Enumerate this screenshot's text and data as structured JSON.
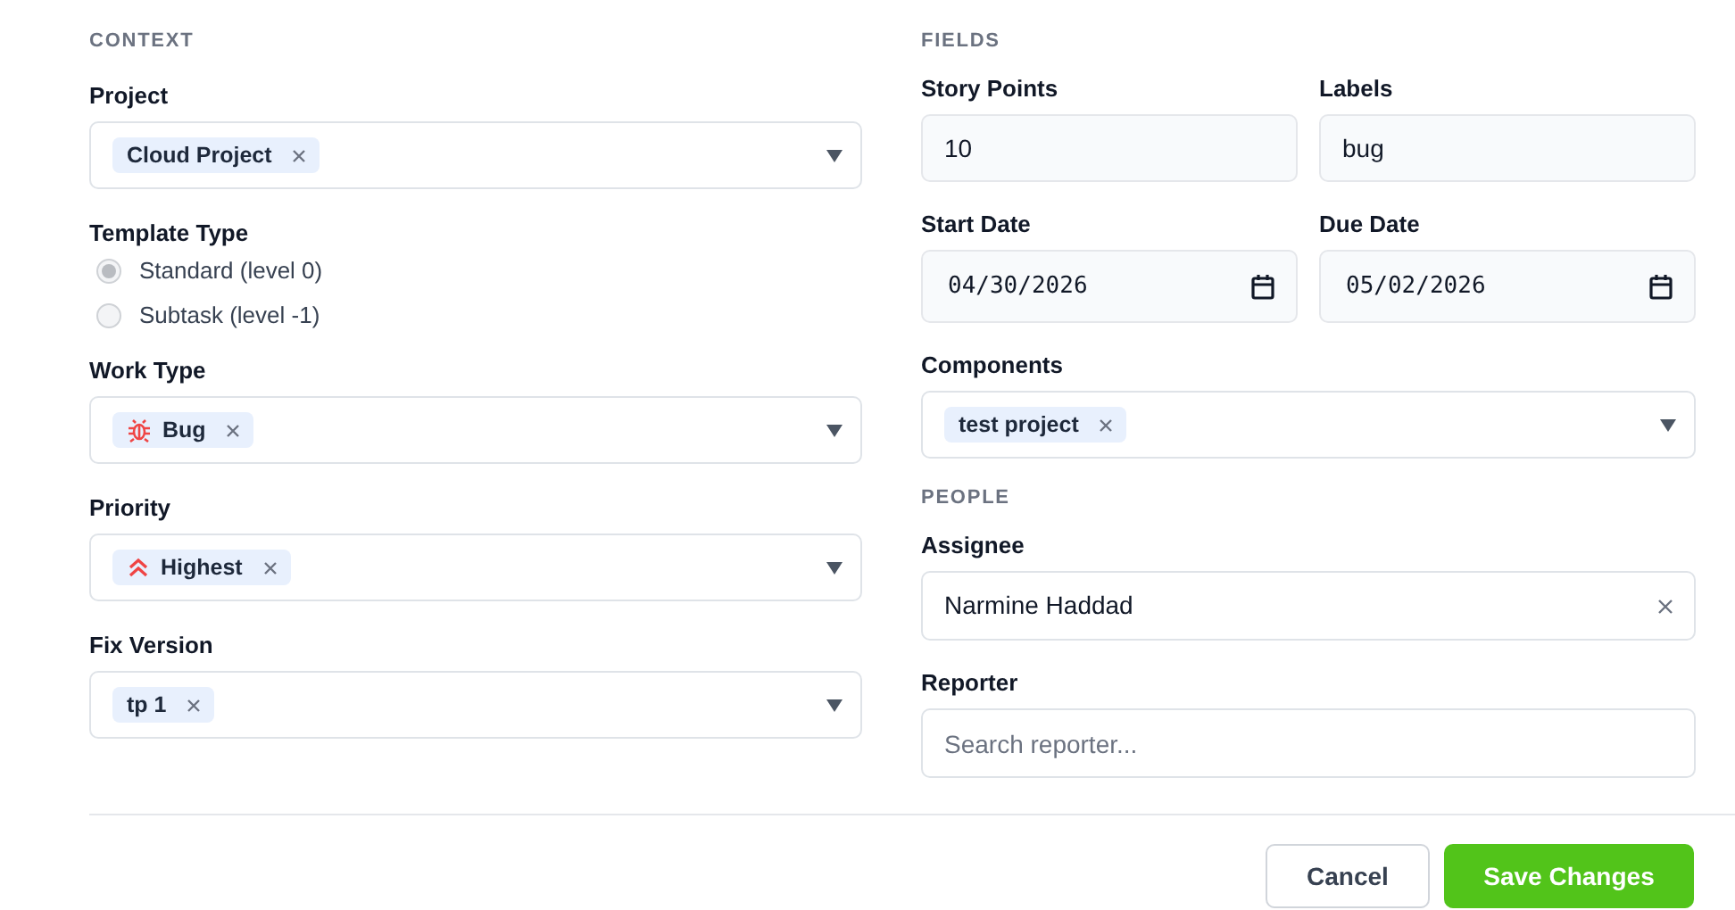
{
  "context": {
    "heading": "CONTEXT",
    "project": {
      "label": "Project",
      "chips": [
        {
          "text": "Cloud Project"
        }
      ]
    },
    "template_type": {
      "label": "Template Type",
      "options": [
        {
          "label": "Standard (level 0)",
          "selected": true
        },
        {
          "label": "Subtask (level -1)",
          "selected": false
        }
      ]
    },
    "work_type": {
      "label": "Work Type",
      "chips": [
        {
          "text": "Bug",
          "kind": "bug"
        }
      ]
    },
    "priority": {
      "label": "Priority",
      "chips": [
        {
          "text": "Highest",
          "kind": "highest"
        }
      ]
    },
    "fix_version": {
      "label": "Fix Version",
      "chips": [
        {
          "text": "tp 1"
        }
      ]
    }
  },
  "fields": {
    "heading": "FIELDS",
    "story_points": {
      "label": "Story Points",
      "value": "10"
    },
    "labels": {
      "label": "Labels",
      "value": "bug"
    },
    "start_date": {
      "label": "Start Date",
      "value": "04/30/2026"
    },
    "due_date": {
      "label": "Due Date",
      "value": "05/02/2026"
    },
    "components": {
      "label": "Components",
      "chips": [
        {
          "text": "test project"
        }
      ]
    }
  },
  "people": {
    "heading": "PEOPLE",
    "assignee": {
      "label": "Assignee",
      "value": "Narmine Haddad"
    },
    "reporter": {
      "label": "Reporter",
      "placeholder": "Search reporter..."
    }
  },
  "buttons": [
    {
      "label": "Cancel",
      "kind": "secondary"
    },
    {
      "label": "Save Changes",
      "kind": "primary"
    }
  ]
}
